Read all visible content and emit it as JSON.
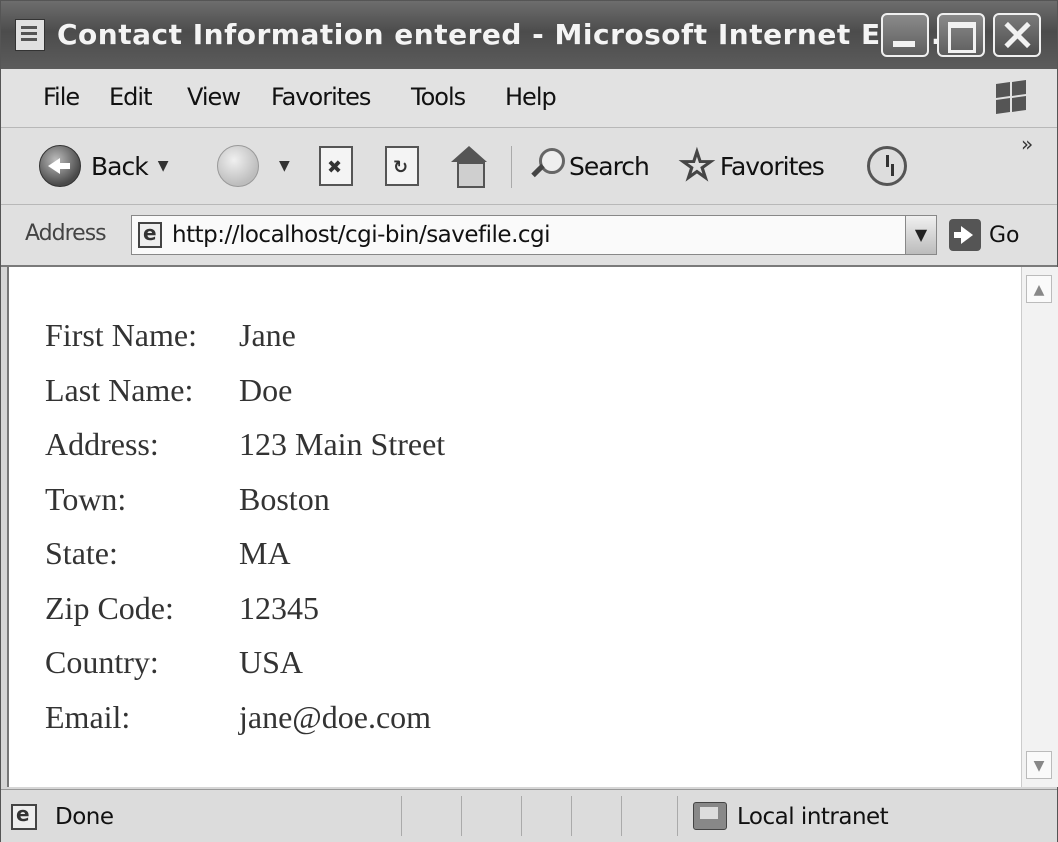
{
  "window": {
    "title": "Contact Information entered - Microsoft Internet Exp..."
  },
  "menu": {
    "items": [
      "File",
      "Edit",
      "View",
      "Favorites",
      "Tools",
      "Help"
    ]
  },
  "toolbar": {
    "back_label": "Back",
    "search_label": "Search",
    "favorites_label": "Favorites",
    "overflow": "»"
  },
  "address": {
    "label": "Address",
    "url": "http://localhost/cgi-bin/savefile.cgi",
    "go_label": "Go"
  },
  "contact": {
    "rows": [
      {
        "label": "First Name:",
        "value": "Jane"
      },
      {
        "label": "Last Name:",
        "value": "Doe"
      },
      {
        "label": "Address:",
        "value": "123 Main Street"
      },
      {
        "label": "Town:",
        "value": "Boston"
      },
      {
        "label": "State:",
        "value": "MA"
      },
      {
        "label": "Zip Code:",
        "value": "12345"
      },
      {
        "label": "Country:",
        "value": "USA"
      },
      {
        "label": "Email:",
        "value": "jane@doe.com"
      }
    ]
  },
  "status": {
    "text": "Done",
    "zone": "Local intranet"
  },
  "icons": {
    "app": "ie-page-icon",
    "back": "back-arrow-icon",
    "forward": "forward-arrow-icon",
    "stop": "stop-icon",
    "refresh": "refresh-icon",
    "home": "home-icon",
    "search": "search-icon",
    "favorites": "star-icon",
    "history": "history-icon",
    "go": "go-arrow-icon"
  }
}
